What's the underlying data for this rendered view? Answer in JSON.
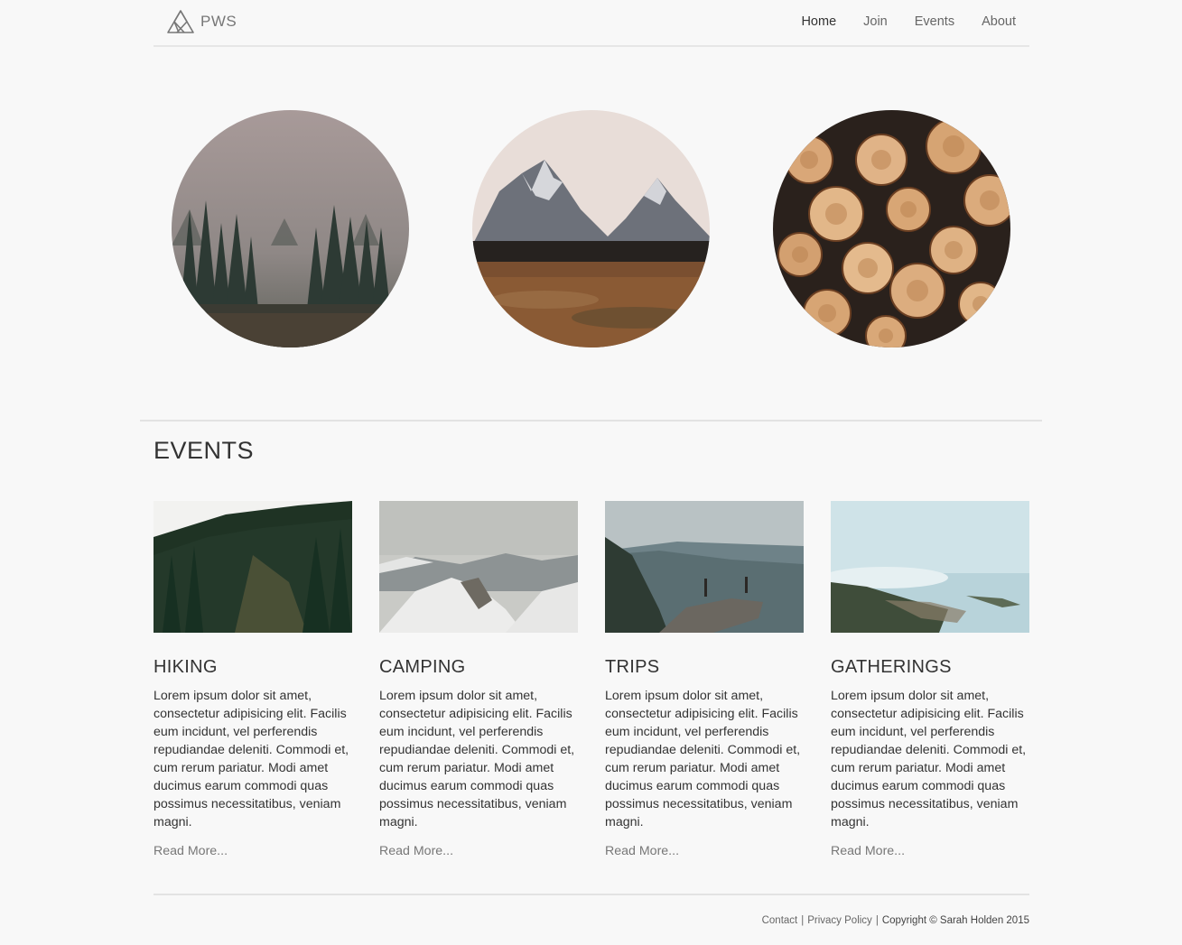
{
  "header": {
    "logo_text": "PWS",
    "nav": [
      {
        "label": "Home"
      },
      {
        "label": "Join"
      },
      {
        "label": "Events"
      },
      {
        "label": "About"
      }
    ]
  },
  "hero": {
    "images": [
      "misty-forest-photo",
      "mountain-range-photo",
      "stacked-logs-photo"
    ]
  },
  "events": {
    "title": "EVENTS",
    "items": [
      {
        "title": "HIKING",
        "body": "Lorem ipsum dolor sit amet, consectetur adipisicing elit. Facilis eum incidunt, vel perferendis repudiandae deleniti. Commodi et, cum rerum pariatur. Modi amet ducimus earum commodi quas possimus necessitatibus, veniam magni.",
        "link": "Read More..."
      },
      {
        "title": "CAMPING",
        "body": "Lorem ipsum dolor sit amet, consectetur adipisicing elit. Facilis eum incidunt, vel perferendis repudiandae deleniti. Commodi et, cum rerum pariatur. Modi amet ducimus earum commodi quas possimus necessitatibus, veniam magni.",
        "link": "Read More..."
      },
      {
        "title": "TRIPS",
        "body": "Lorem ipsum dolor sit amet, consectetur adipisicing elit. Facilis eum incidunt, vel perferendis repudiandae deleniti. Commodi et, cum rerum pariatur. Modi amet ducimus earum commodi quas possimus necessitatibus, veniam magni.",
        "link": "Read More..."
      },
      {
        "title": "GATHERINGS",
        "body": "Lorem ipsum dolor sit amet, consectetur adipisicing elit. Facilis eum incidunt, vel perferendis repudiandae deleniti. Commodi et, cum rerum pariatur. Modi amet ducimus earum commodi quas possimus necessitatibus, veniam magni.",
        "link": "Read More..."
      }
    ]
  },
  "footer": {
    "contact": "Contact",
    "privacy": "Privacy Policy",
    "separator": "|",
    "copyright": "Copyright © Sarah Holden 2015"
  }
}
